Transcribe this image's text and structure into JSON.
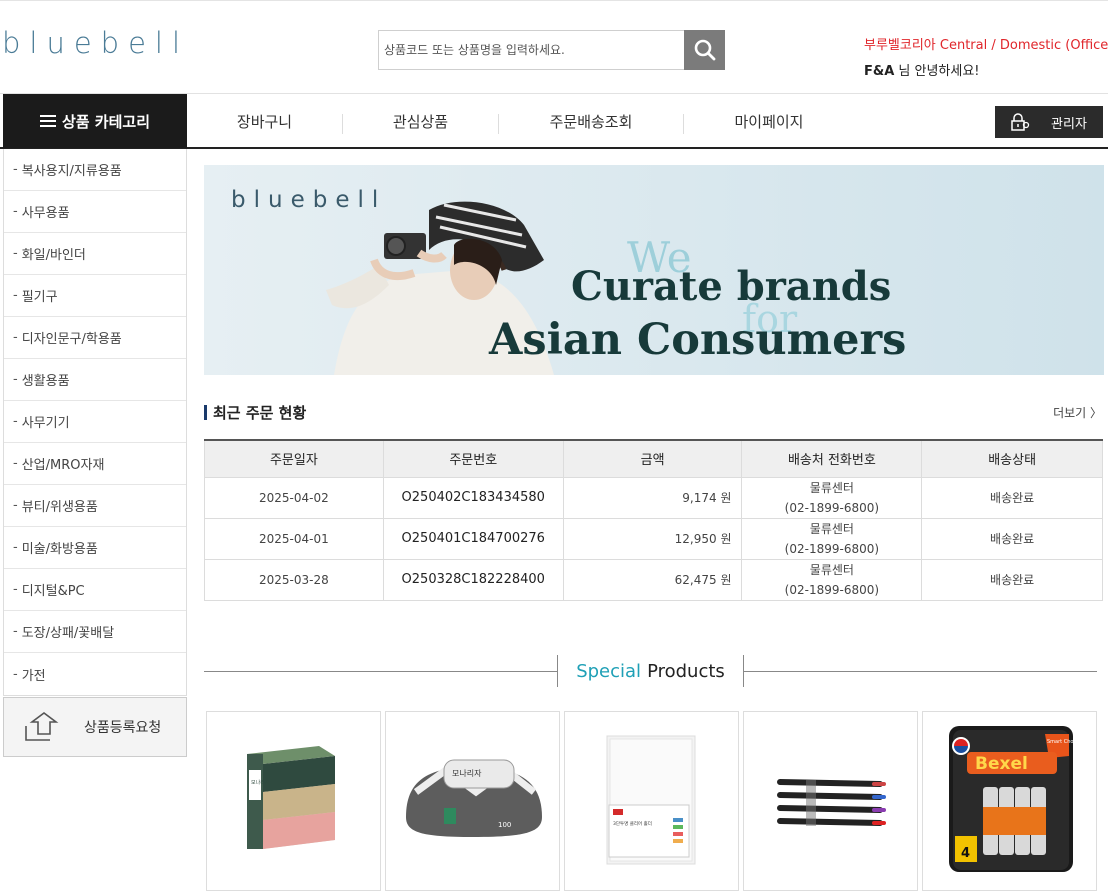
{
  "header": {
    "logo": "bluebell",
    "search_placeholder": "상품코드 또는 상품명을 입력하세요.",
    "company": "부루벨코리아 Central / Domestic (Office)",
    "user_name": "F&A",
    "greeting": " 님 안녕하세요!"
  },
  "nav": {
    "category_label": "상품 카테고리",
    "items": [
      "장바구니",
      "관심상품",
      "주문배송조회",
      "마이페이지"
    ],
    "admin_label": "관리자"
  },
  "sidebar": {
    "items": [
      "복사용지/지류용품",
      "사무용품",
      "화일/바인더",
      "필기구",
      "디자인문구/학용품",
      "생활용품",
      "사무기기",
      "산업/MRO자재",
      "뷰티/위생용품",
      "미술/화방용품",
      "디지털&PC",
      "도장/상패/꽃배달",
      "가전"
    ],
    "register_label": "상품등록요청"
  },
  "banner": {
    "logo": "bluebell",
    "we": "We",
    "line1": "Curate brands",
    "for": "for",
    "line2": "Asian Consumers"
  },
  "orders": {
    "title": "최근 주문 현황",
    "more": "더보기 〉",
    "columns": [
      "주문일자",
      "주문번호",
      "금액",
      "배송처 전화번호",
      "배송상태"
    ],
    "rows": [
      {
        "date": "2025-04-02",
        "order_no": "O250402C183434580",
        "amount": "9,174 원",
        "place": "물류센터",
        "phone": "(02-1899-6800)",
        "status": "배송완료"
      },
      {
        "date": "2025-04-01",
        "order_no": "O250401C184700276",
        "amount": "12,950 원",
        "place": "물류센터",
        "phone": "(02-1899-6800)",
        "status": "배송완료"
      },
      {
        "date": "2025-03-28",
        "order_no": "O250328C182228400",
        "amount": "62,475 원",
        "place": "물류센터",
        "phone": "(02-1899-6800)",
        "status": "배송완료"
      }
    ]
  },
  "special": {
    "word1": "Special",
    "word2": "Products",
    "products": [
      {
        "name": "tissue-box-product",
        "label": "모나리자"
      },
      {
        "name": "wet-wipes-product",
        "label": "모나리자",
        "count": "100"
      },
      {
        "name": "clear-file-product",
        "label": "3단투명 클리어 홀더"
      },
      {
        "name": "ballpoint-pens-product"
      },
      {
        "name": "bexel-battery-product",
        "brand": "Bexel",
        "pack": "4",
        "tag": "Smart Choice"
      }
    ]
  },
  "colors": {
    "accent_red": "#e0262b",
    "logo_blue": "#4a7b96",
    "special_cyan": "#1fa0b6",
    "dark": "#1b1b1b"
  }
}
